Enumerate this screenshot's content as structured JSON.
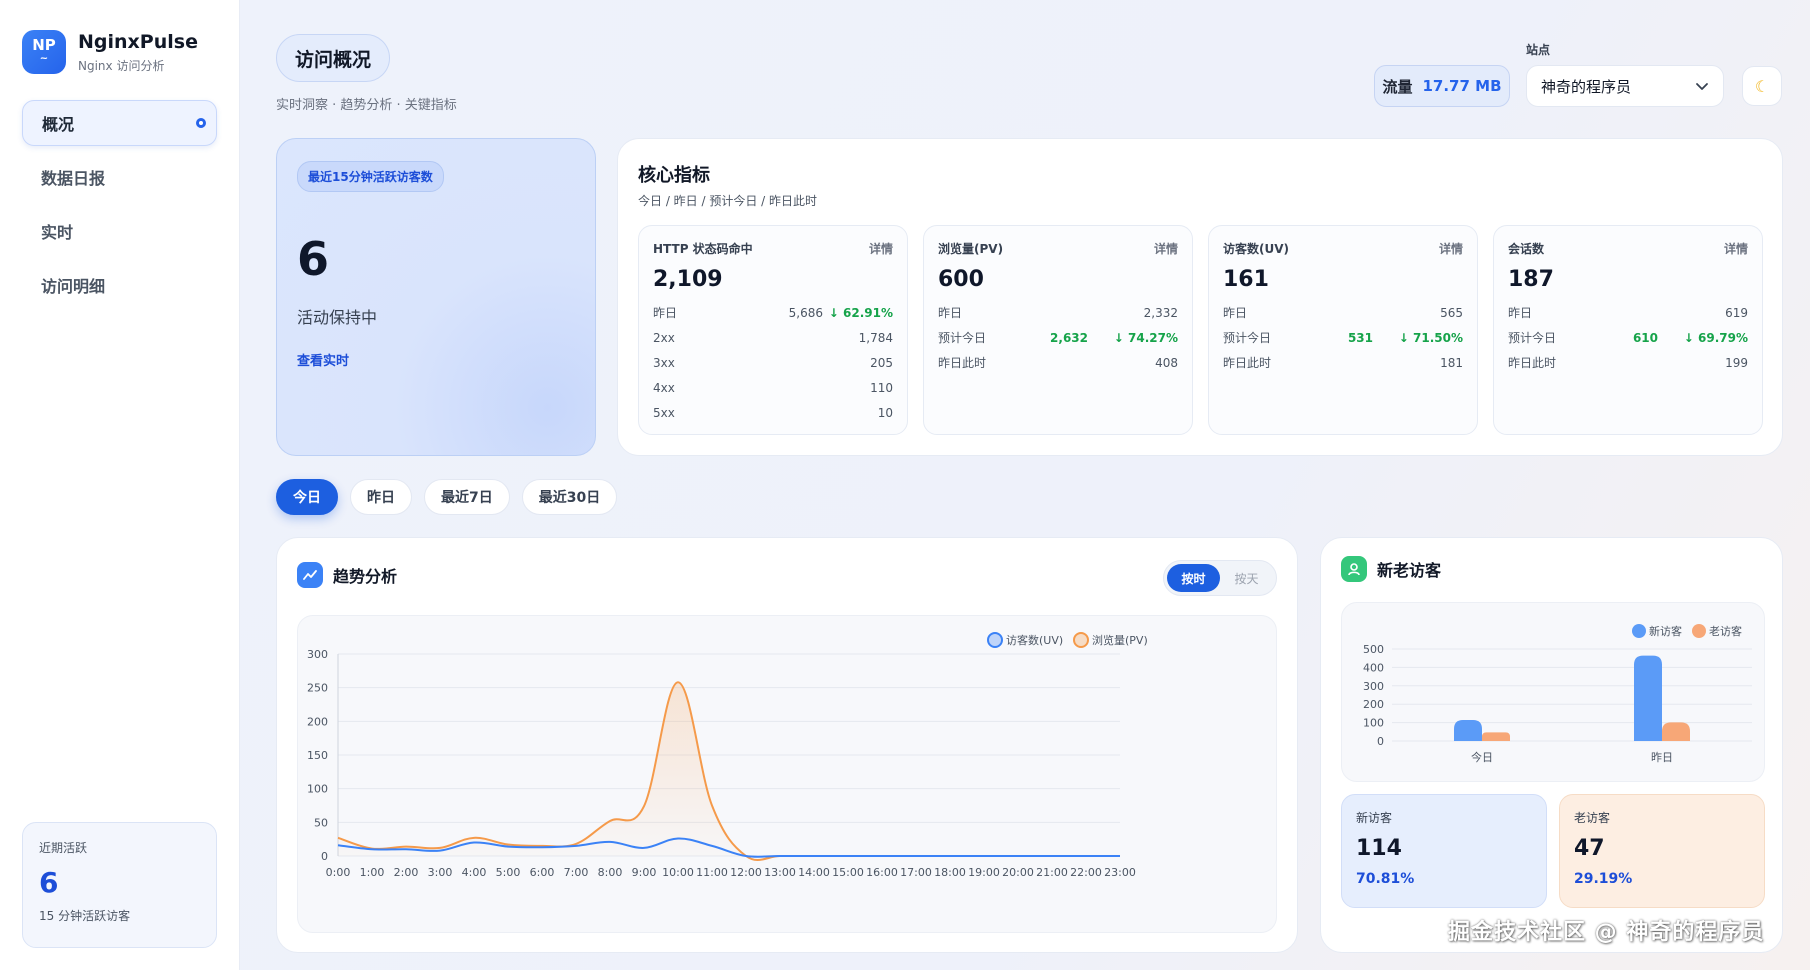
{
  "brand": {
    "logo": "NP",
    "name": "NginxPulse",
    "subtitle": "Nginx 访问分析"
  },
  "nav": {
    "items": [
      {
        "label": "概况"
      },
      {
        "label": "数据日报"
      },
      {
        "label": "实时"
      },
      {
        "label": "访问明细"
      }
    ]
  },
  "recent": {
    "label": "近期活跃",
    "value": "6",
    "sub": "15 分钟活跃访客"
  },
  "header": {
    "title": "访问概况",
    "subtitle": "实时洞察 · 趋势分析 · 关键指标",
    "traffic_label": "流量",
    "traffic_value": "17.77 MB",
    "site_label": "站点",
    "site_value": "神奇的程序员"
  },
  "active": {
    "badge": "最近15分钟活跃访客数",
    "value": "6",
    "state": "活动保持中",
    "link": "查看实时"
  },
  "core": {
    "title": "核心指标",
    "subtitle": "今日 / 昨日 / 预计今日 / 昨日此时",
    "detail_label": "详情",
    "status": {
      "title": "HTTP 状态码命中",
      "value": "2,109",
      "yesterday_label": "昨日",
      "yesterday_value": "5,686",
      "yesterday_pct": "↓ 62.91%",
      "rows": [
        {
          "k": "2xx",
          "v": "1,784"
        },
        {
          "k": "3xx",
          "v": "205"
        },
        {
          "k": "4xx",
          "v": "110"
        },
        {
          "k": "5xx",
          "v": "10"
        }
      ]
    },
    "pv": {
      "title": "浏览量(PV)",
      "value": "600",
      "yesterday_label": "昨日",
      "yesterday_value": "2,332",
      "forecast_label": "预计今日",
      "forecast_value": "2,632",
      "forecast_pct": "↓ 74.27%",
      "same_time_label": "昨日此时",
      "same_time_value": "408"
    },
    "uv": {
      "title": "访客数(UV)",
      "value": "161",
      "yesterday_label": "昨日",
      "yesterday_value": "565",
      "forecast_label": "预计今日",
      "forecast_value": "531",
      "forecast_pct": "↓ 71.50%",
      "same_time_label": "昨日此时",
      "same_time_value": "181"
    },
    "sessions": {
      "title": "会话数",
      "value": "187",
      "yesterday_label": "昨日",
      "yesterday_value": "619",
      "forecast_label": "预计今日",
      "forecast_value": "610",
      "forecast_pct": "↓ 69.79%",
      "same_time_label": "昨日此时",
      "same_time_value": "199"
    }
  },
  "range_tabs": [
    {
      "label": "今日"
    },
    {
      "label": "昨日"
    },
    {
      "label": "最近7日"
    },
    {
      "label": "最近30日"
    }
  ],
  "trend": {
    "title": "趋势分析",
    "toggle_hourly": "按时",
    "toggle_daily": "按天"
  },
  "visitors": {
    "title": "新老访客",
    "new_label": "新访客",
    "new_value": "114",
    "new_pct": "70.81%",
    "old_label": "老访客",
    "old_value": "47",
    "old_pct": "29.19%"
  },
  "watermark": "掘金技术社区 @ 神奇的程序员",
  "colors": {
    "accent": "#1d5fe0",
    "uv": "#3b82f6",
    "pv": "#f59a4a",
    "new": "#5b9bf7",
    "old": "#f7a777",
    "green": "#16a34a"
  },
  "chart_data": [
    {
      "type": "line",
      "x": [
        "0:00",
        "1:00",
        "2:00",
        "3:00",
        "4:00",
        "5:00",
        "6:00",
        "7:00",
        "8:00",
        "9:00",
        "10:00",
        "11:00",
        "12:00",
        "13:00",
        "14:00",
        "15:00",
        "16:00",
        "17:00",
        "18:00",
        "19:00",
        "20:00",
        "21:00",
        "22:00",
        "23:00"
      ],
      "series": [
        {
          "name": "访客数(UV)",
          "color": "#3b82f6",
          "values": [
            16,
            10,
            10,
            8,
            20,
            14,
            13,
            15,
            21,
            12,
            26,
            15,
            0,
            0,
            0,
            0,
            0,
            0,
            0,
            0,
            0,
            0,
            0,
            0
          ]
        },
        {
          "name": "浏览量(PV)",
          "color": "#f59a4a",
          "values": [
            27,
            11,
            14,
            12,
            27,
            17,
            15,
            18,
            52,
            74,
            258,
            75,
            0,
            0,
            0,
            0,
            0,
            0,
            0,
            0,
            0,
            0,
            0,
            0
          ]
        }
      ],
      "yticks": [
        "0",
        "50",
        "100",
        "150",
        "200",
        "250",
        "300"
      ],
      "ylim": [
        0,
        300
      ],
      "legend": "top-right"
    },
    {
      "type": "bar",
      "categories": [
        "今日",
        "昨日"
      ],
      "series": [
        {
          "name": "新访客",
          "color": "#5b9bf7",
          "values": [
            114,
            464
          ]
        },
        {
          "name": "老访客",
          "color": "#f7a777",
          "values": [
            47,
            101
          ]
        }
      ],
      "yticks": [
        "0",
        "100",
        "200",
        "300",
        "400",
        "500"
      ],
      "ylim": [
        0,
        500
      ],
      "legend": "top-right"
    }
  ]
}
